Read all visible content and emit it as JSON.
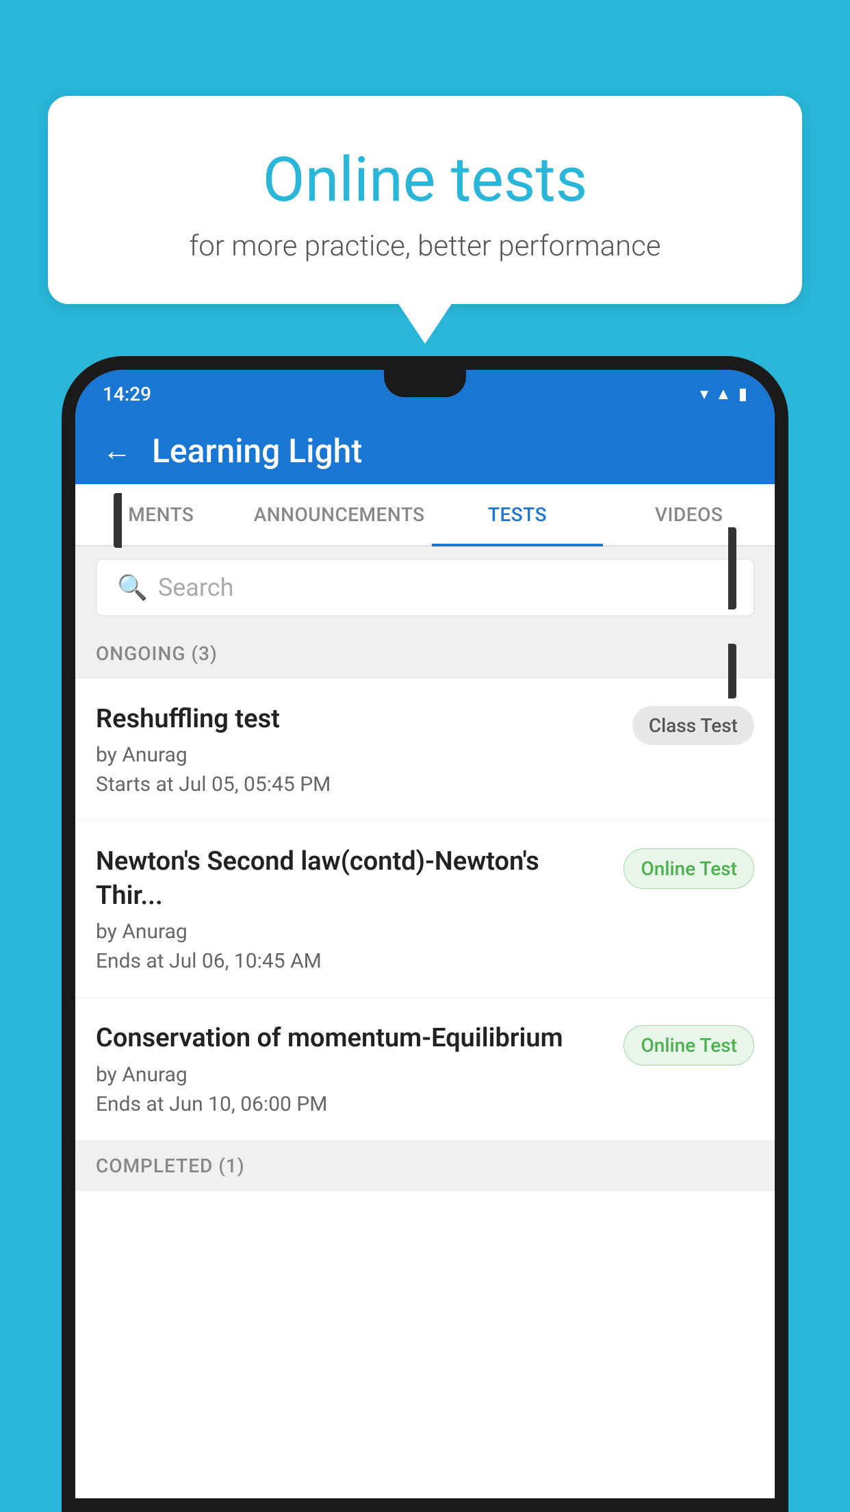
{
  "background_color": "#29b6d8",
  "speech_bubble": {
    "title": "Online tests",
    "subtitle": "for more practice, better performance"
  },
  "phone": {
    "status_bar": {
      "time": "14:29",
      "icons": [
        "wifi",
        "signal",
        "battery"
      ]
    },
    "app_header": {
      "back_label": "←",
      "title": "Learning Light"
    },
    "tabs": [
      {
        "label": "MENTS",
        "active": false
      },
      {
        "label": "ANNOUNCEMENTS",
        "active": false
      },
      {
        "label": "TESTS",
        "active": true
      },
      {
        "label": "VIDEOS",
        "active": false
      }
    ],
    "search": {
      "placeholder": "Search"
    },
    "ongoing_section": {
      "label": "ONGOING (3)"
    },
    "tests": [
      {
        "name": "Reshuffling test",
        "by": "by Anurag",
        "date": "Starts at  Jul 05, 05:45 PM",
        "badge": "Class Test",
        "badge_type": "class"
      },
      {
        "name": "Newton's Second law(contd)-Newton's Thir...",
        "by": "by Anurag",
        "date": "Ends at  Jul 06, 10:45 AM",
        "badge": "Online Test",
        "badge_type": "online"
      },
      {
        "name": "Conservation of momentum-Equilibrium",
        "by": "by Anurag",
        "date": "Ends at  Jun 10, 06:00 PM",
        "badge": "Online Test",
        "badge_type": "online"
      }
    ],
    "completed_section": {
      "label": "COMPLETED (1)"
    }
  }
}
